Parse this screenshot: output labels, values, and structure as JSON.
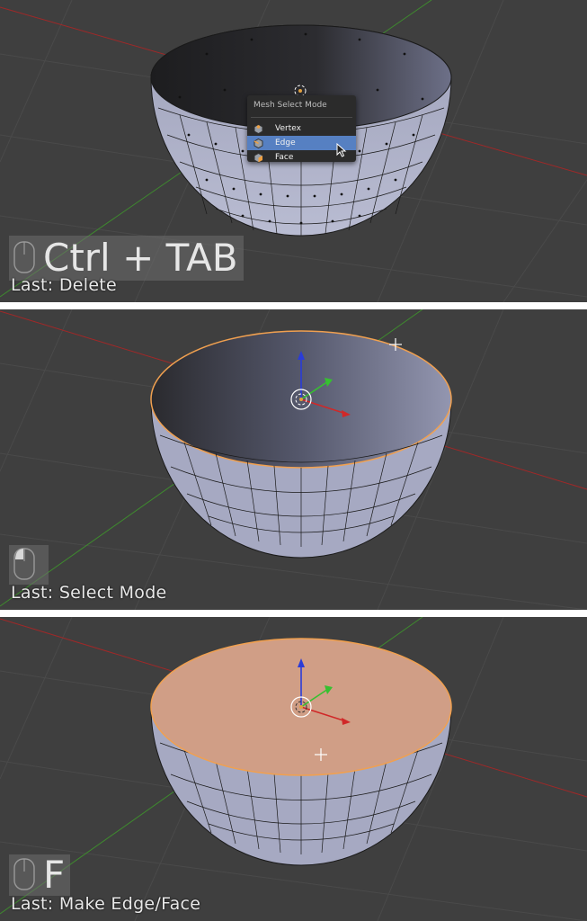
{
  "panels": [
    {
      "key_label": "Ctrl + TAB",
      "last_operator": "Last: Delete",
      "menu": {
        "title": "Mesh Select Mode",
        "items": [
          {
            "label": "Vertex",
            "icon": "vertex-mode-icon",
            "active": false
          },
          {
            "label": "Edge",
            "icon": "edge-mode-icon",
            "active": true
          },
          {
            "label": "Face",
            "icon": "face-mode-icon",
            "active": false
          }
        ]
      }
    },
    {
      "key_label": "",
      "last_operator": "Last: Select Mode"
    },
    {
      "key_label": "F",
      "last_operator": "Last: Make Edge/Face"
    }
  ],
  "colors": {
    "viewport_bg": "#3f3f3f",
    "mesh": "#a9acc4",
    "selection": "#f0a050",
    "filled_face": "#d09e86",
    "menu_highlight": "#5680c2"
  }
}
